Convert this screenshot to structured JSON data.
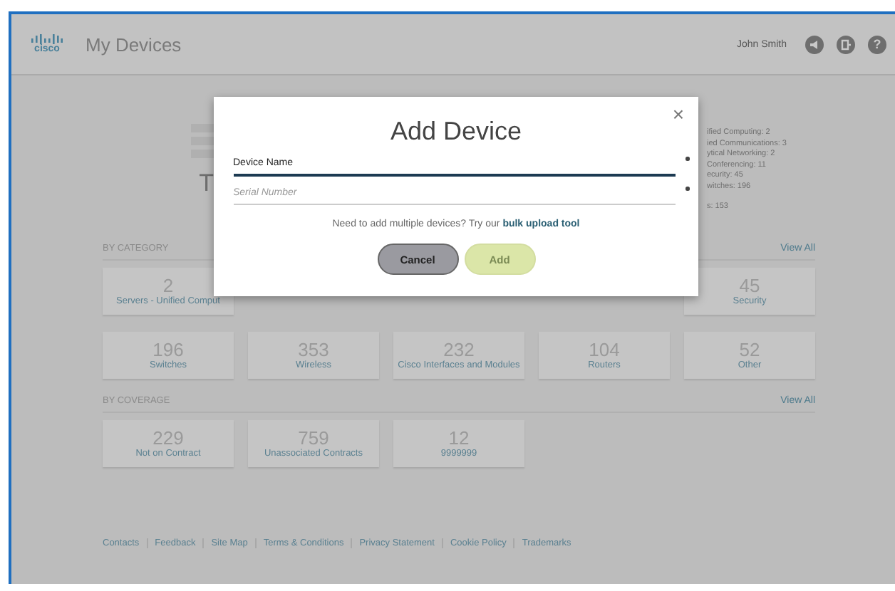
{
  "header": {
    "logo_text": "cisco",
    "title": "My Devices",
    "user": "John Smith",
    "help_glyph": "?"
  },
  "summary": {
    "title_fragment": "T",
    "legend_fragments": [
      "ified Computing: 2",
      "ied Communications: 3",
      "ytical Networking: 2",
      "Conferencing: 11",
      "ecurity: 45",
      "witches: 196",
      "s: 153"
    ]
  },
  "sections": [
    {
      "label": "BY CATEGORY",
      "link": "View All",
      "rows": [
        [
          {
            "count": "2",
            "name": "Servers - Unified Comput"
          },
          {},
          {},
          {},
          {
            "count": "45",
            "name": "Security"
          }
        ],
        [
          {
            "count": "196",
            "name": "Switches"
          },
          {
            "count": "353",
            "name": "Wireless"
          },
          {
            "count": "232",
            "name": "Cisco Interfaces and Modules"
          },
          {
            "count": "104",
            "name": "Routers"
          },
          {
            "count": "52",
            "name": "Other"
          }
        ]
      ]
    },
    {
      "label": "BY COVERAGE",
      "link": "View All",
      "rows": [
        [
          {
            "count": "229",
            "name": "Not on Contract"
          },
          {
            "count": "759",
            "name": "Unassociated Contracts"
          },
          {
            "count": "12",
            "name": "9999999"
          }
        ]
      ]
    }
  ],
  "footer": [
    "Contacts",
    "Feedback",
    "Site Map",
    "Terms & Conditions",
    "Privacy Statement",
    "Cookie Policy",
    "Trademarks"
  ],
  "dialog": {
    "title": "Add Device",
    "close": "×",
    "fields": [
      {
        "placeholder": "Device Name",
        "focused": true,
        "required": true
      },
      {
        "placeholder": "Serial Number",
        "focused": false,
        "required": true
      }
    ],
    "hint": "Need to add multiple devices? Try our",
    "hint_link": "bulk upload tool",
    "buttons": [
      {
        "label": "Cancel",
        "kind": "secondary"
      },
      {
        "label": "Add",
        "kind": "primary"
      }
    ]
  }
}
